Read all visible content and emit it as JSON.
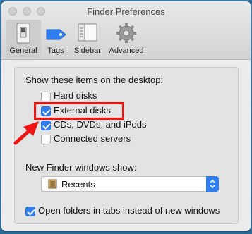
{
  "window": {
    "title": "Finder Preferences"
  },
  "toolbar": {
    "tabs": [
      {
        "label": "General",
        "icon": "general-switch-icon",
        "selected": true
      },
      {
        "label": "Tags",
        "icon": "tag-icon",
        "selected": false
      },
      {
        "label": "Sidebar",
        "icon": "sidebar-icon",
        "selected": false
      },
      {
        "label": "Advanced",
        "icon": "gear-icon",
        "selected": false
      }
    ]
  },
  "desktop": {
    "heading": "Show these items on the desktop:",
    "items": [
      {
        "label": "Hard disks",
        "checked": false
      },
      {
        "label": "External disks",
        "checked": true
      },
      {
        "label": "CDs, DVDs, and iPods",
        "checked": true
      },
      {
        "label": "Connected servers",
        "checked": false
      }
    ]
  },
  "new_window": {
    "heading": "New Finder windows show:",
    "selected": "Recents"
  },
  "tabs_option": {
    "label": "Open folders in tabs instead of new windows",
    "checked": true
  },
  "colors": {
    "accent": "#2f7ef0",
    "annotation": "#ee1414"
  }
}
